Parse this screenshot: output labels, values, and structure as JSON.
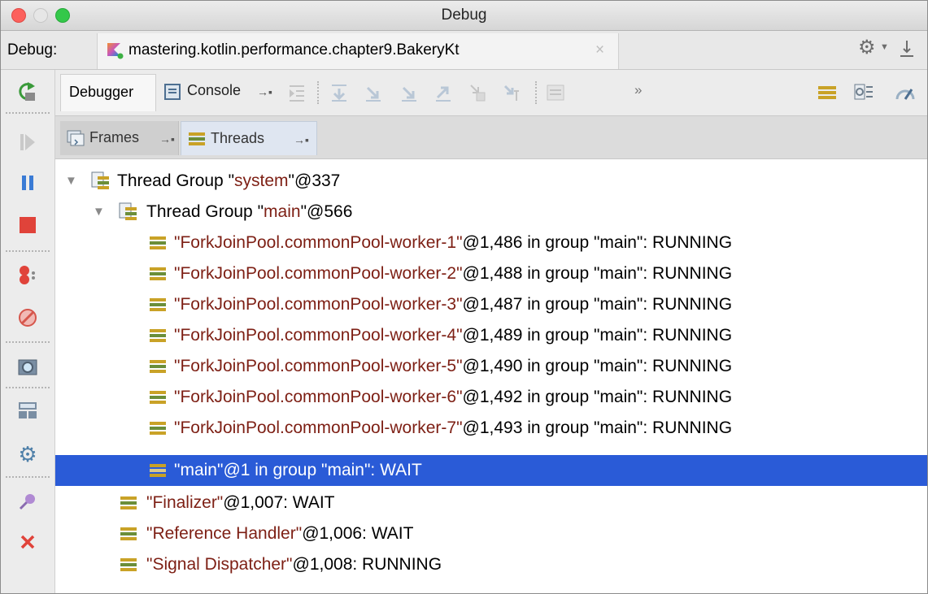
{
  "window": {
    "title": "Debug"
  },
  "tab_bar": {
    "label": "Debug:",
    "session_tab": "mastering.kotlin.performance.chapter9.BakeryKt",
    "close_glyph": "×"
  },
  "debugger_toolbar": {
    "debugger_tab": "Debugger",
    "console_tab": "Console",
    "more_glyph": "»"
  },
  "panel_tabs": {
    "frames": "Frames",
    "threads": "Threads"
  },
  "threads": {
    "groups": [
      {
        "prefix": "Thread Group \"",
        "name": "system",
        "suffix": "\"@337"
      },
      {
        "prefix": "Thread Group \"",
        "name": "main",
        "suffix": "\"@566"
      }
    ],
    "items": [
      {
        "name": "\"ForkJoinPool.commonPool-worker-1\"",
        "detail": "@1,486 in group \"main\": RUNNING"
      },
      {
        "name": "\"ForkJoinPool.commonPool-worker-2\"",
        "detail": "@1,488 in group \"main\": RUNNING"
      },
      {
        "name": "\"ForkJoinPool.commonPool-worker-3\"",
        "detail": "@1,487 in group \"main\": RUNNING"
      },
      {
        "name": "\"ForkJoinPool.commonPool-worker-4\"",
        "detail": "@1,489 in group \"main\": RUNNING"
      },
      {
        "name": "\"ForkJoinPool.commonPool-worker-5\"",
        "detail": "@1,490 in group \"main\": RUNNING"
      },
      {
        "name": "\"ForkJoinPool.commonPool-worker-6\"",
        "detail": "@1,492 in group \"main\": RUNNING"
      },
      {
        "name": "\"ForkJoinPool.commonPool-worker-7\"",
        "detail": "@1,493 in group \"main\": RUNNING"
      },
      {
        "name": "\"main\"",
        "detail": "@1 in group \"main\": WAIT"
      },
      {
        "name": "\"Finalizer\"",
        "detail": "@1,007: WAIT"
      },
      {
        "name": "\"Reference Handler\"",
        "detail": "@1,006: WAIT"
      },
      {
        "name": "\"Signal Dispatcher\"",
        "detail": "@1,008: RUNNING"
      }
    ],
    "selected_item": "\"main\"@1 in group \"main\": WAIT"
  },
  "colors": {
    "selection": "#2a5bd7",
    "thread_name": "#7d1f14",
    "stop_red": "#e0433a",
    "pause_blue": "#3a7bd5",
    "resume_green": "#3a9a3a"
  }
}
